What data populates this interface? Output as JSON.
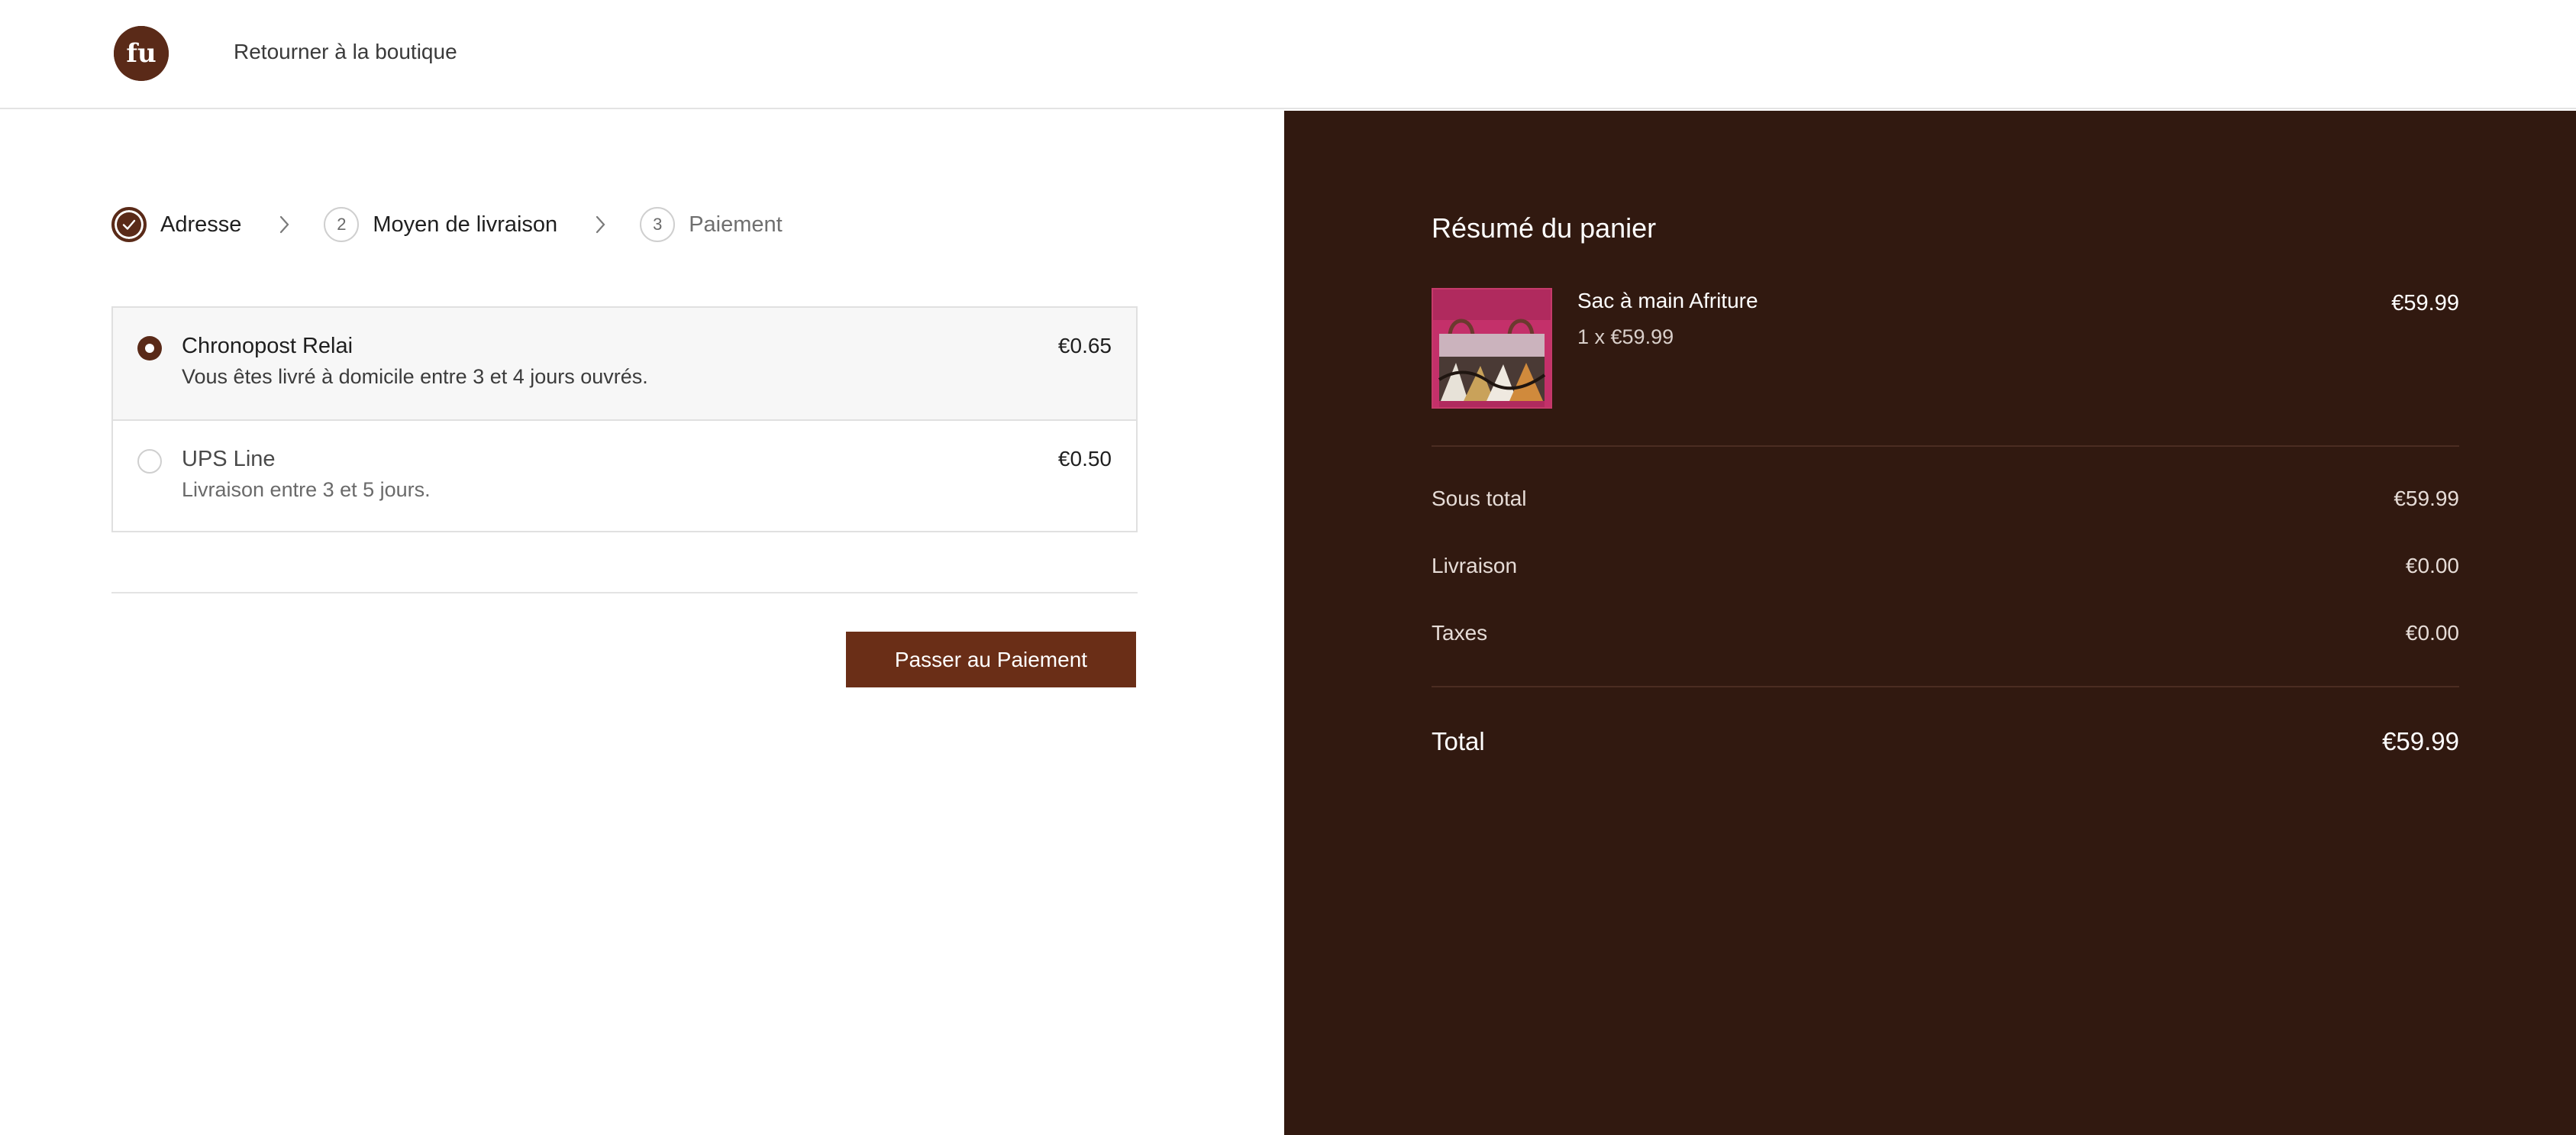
{
  "header": {
    "back_link": "Retourner à la boutique",
    "logo_letters": "fu",
    "logo_icon": "afriture-logo"
  },
  "steps": [
    {
      "number": "1",
      "label": "Adresse",
      "state": "completed",
      "icon": "check-icon"
    },
    {
      "number": "2",
      "label": "Moyen de livraison",
      "state": "current"
    },
    {
      "number": "3",
      "label": "Paiement",
      "state": "upcoming"
    }
  ],
  "step_separator_icon": "chevron-right-icon",
  "shipping_options": [
    {
      "name": "Chronopost Relai",
      "description": "Vous êtes livré à domicile entre 3 et 4 jours ouvrés.",
      "price": "€0.65",
      "selected": true
    },
    {
      "name": "UPS Line",
      "description": "Livraison entre 3 et 5 jours.",
      "price": "€0.50",
      "selected": false
    }
  ],
  "actions": {
    "continue_label": "Passer au Paiement"
  },
  "summary": {
    "title": "Résumé du panier",
    "item": {
      "name": "Sac à main Afriture",
      "quantity_line": "1 x €59.99",
      "price": "€59.99"
    },
    "subtotal_label": "Sous total",
    "subtotal_value": "€59.99",
    "shipping_label": "Livraison",
    "shipping_value": "€0.00",
    "taxes_label": "Taxes",
    "taxes_value": "€0.00",
    "total_label": "Total",
    "total_value": "€59.99"
  },
  "colors": {
    "brand_brown": "#5a2a18",
    "button_brown": "#6a2e17",
    "summary_background": "#311910"
  }
}
